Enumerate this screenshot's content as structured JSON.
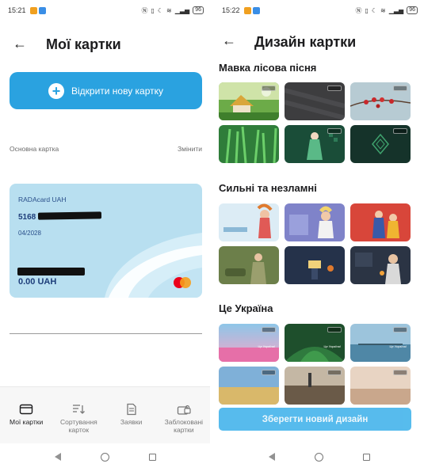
{
  "left": {
    "status": {
      "time": "15:21",
      "battery": "96"
    },
    "title": "Мої картки",
    "open_card_label": "Відкрити нову картку",
    "main_card_label": "Основна картка",
    "change_label": "Змінити",
    "card": {
      "name": "RADAcard UAH",
      "number_prefix": "5168",
      "expiry": "04/2028",
      "balance": "0.00 UAH"
    },
    "bottom_nav": [
      {
        "label": "Мої картки",
        "icon": "card-icon",
        "active": true
      },
      {
        "label": "Сортування карток",
        "icon": "sort-icon",
        "active": false
      },
      {
        "label": "Заявки",
        "icon": "document-icon",
        "active": false
      },
      {
        "label": "Заблоковані картки",
        "icon": "lock-card-icon",
        "active": false
      }
    ]
  },
  "right": {
    "status": {
      "time": "15:22",
      "battery": "96"
    },
    "title": "Дизайн картки",
    "sections": [
      {
        "title": "Мавка лісова пісня"
      },
      {
        "title": "Сильні та незламні"
      },
      {
        "title": "Це Україна"
      }
    ],
    "tile_caption": "Це Україна!",
    "save_label": "Зберегти новий дизайн"
  },
  "colors": {
    "accent": "#2aa2e0",
    "card_bg": "#b8dff0",
    "card_text": "#1d3d7a"
  }
}
